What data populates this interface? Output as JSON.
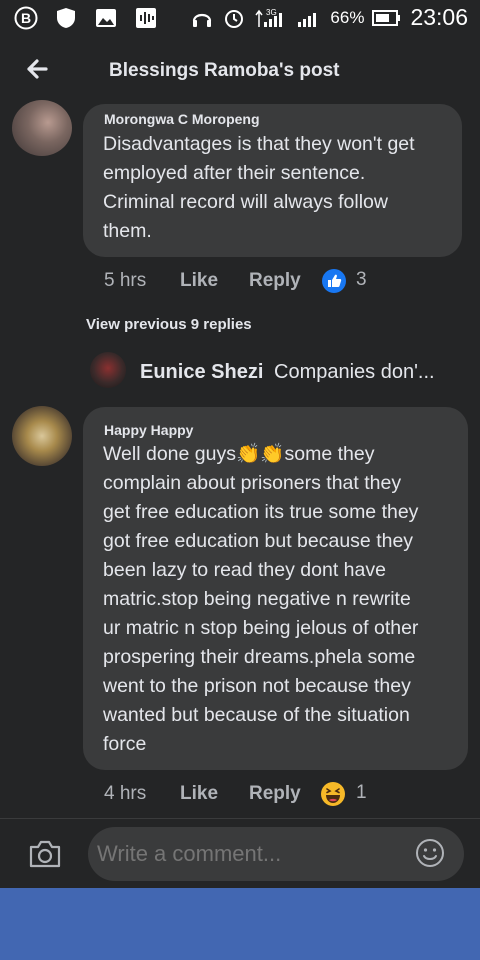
{
  "status_bar": {
    "icons": [
      "b-circle-icon",
      "shield-icon",
      "image-icon",
      "audio-icon",
      "headphones-icon",
      "alarm-icon",
      "signal-icon",
      "signal-icon",
      "battery-icon"
    ],
    "network": "3G",
    "battery_percent": "66%",
    "time": "23:06"
  },
  "header": {
    "title": "Blessings Ramoba's post"
  },
  "comments": [
    {
      "author": "Morongwa C Moropeng",
      "lines": [
        "Disadvantages is that they won't get",
        "employed after their sentence.",
        "Criminal record will always follow",
        "them."
      ],
      "time": "5 hrs",
      "like_label": "Like",
      "reply_label": "Reply",
      "reaction": "like-reaction-icon",
      "reaction_count": "3"
    },
    {
      "author": "Happy Happy",
      "lines": [
        "Well done guys👏👏some they",
        "complain about prisoners that they",
        "get free education its true some they",
        "got free education but because they",
        "been lazy to read they dont have",
        "matric.stop being negative n rewrite",
        "ur matric n stop being jelous of other",
        "prospering their dreams.phela some",
        "went to the prison not because they",
        "wanted but because of the situation",
        "force"
      ],
      "time": "4 hrs",
      "like_label": "Like",
      "reply_label": "Reply",
      "reaction": "haha-reaction-icon",
      "reaction_count": "1"
    }
  ],
  "view_previous": "View previous 9 replies",
  "reply_preview": {
    "author": "Eunice Shezi",
    "snippet": "Companies don'..."
  },
  "composer": {
    "placeholder": "Write a comment..."
  },
  "colors": {
    "background": "#242526",
    "bubble": "#3a3b3c",
    "text": "#e4e6eb",
    "muted": "#b0b3b8",
    "brand": "#4267b2",
    "like_blue": "#1877f2",
    "haha_yellow": "#f7b928"
  }
}
